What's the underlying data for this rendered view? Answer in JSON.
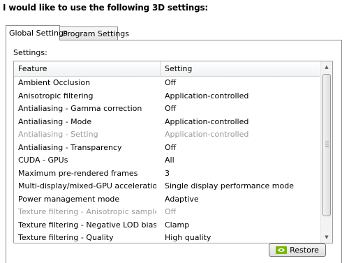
{
  "heading": "I would like to use the following 3D settings:",
  "tabs": [
    {
      "label": "Global Settings",
      "active": true
    },
    {
      "label": "Program Settings",
      "active": false
    }
  ],
  "settings_label": "Settings:",
  "table": {
    "columns": [
      "Feature",
      "Setting"
    ],
    "rows": [
      {
        "feature": "Ambient Occlusion",
        "setting": "Off",
        "disabled": false
      },
      {
        "feature": "Anisotropic filtering",
        "setting": "Application-controlled",
        "disabled": false
      },
      {
        "feature": "Antialiasing - Gamma correction",
        "setting": "Off",
        "disabled": false
      },
      {
        "feature": "Antialiasing - Mode",
        "setting": "Application-controlled",
        "disabled": false
      },
      {
        "feature": "Antialiasing - Setting",
        "setting": "Application-controlled",
        "disabled": true
      },
      {
        "feature": "Antialiasing - Transparency",
        "setting": "Off",
        "disabled": false
      },
      {
        "feature": "CUDA - GPUs",
        "setting": "All",
        "disabled": false
      },
      {
        "feature": "Maximum pre-rendered frames",
        "setting": "3",
        "disabled": false
      },
      {
        "feature": "Multi-display/mixed-GPU acceleration",
        "setting": "Single display performance mode",
        "disabled": false
      },
      {
        "feature": "Power management mode",
        "setting": "Adaptive",
        "disabled": false
      },
      {
        "feature": "Texture filtering - Anisotropic sample opti...",
        "setting": "Off",
        "disabled": true
      },
      {
        "feature": "Texture filtering - Negative LOD bias",
        "setting": "Clamp",
        "disabled": false
      },
      {
        "feature": "Texture filtering - Quality",
        "setting": "High quality",
        "disabled": false
      }
    ]
  },
  "restore_button": {
    "label": "Restore",
    "icon": "nvidia-icon"
  },
  "colors": {
    "accent_green": "#76b900",
    "disabled_text": "#9a9a9a",
    "border": "#8d8d8d"
  }
}
